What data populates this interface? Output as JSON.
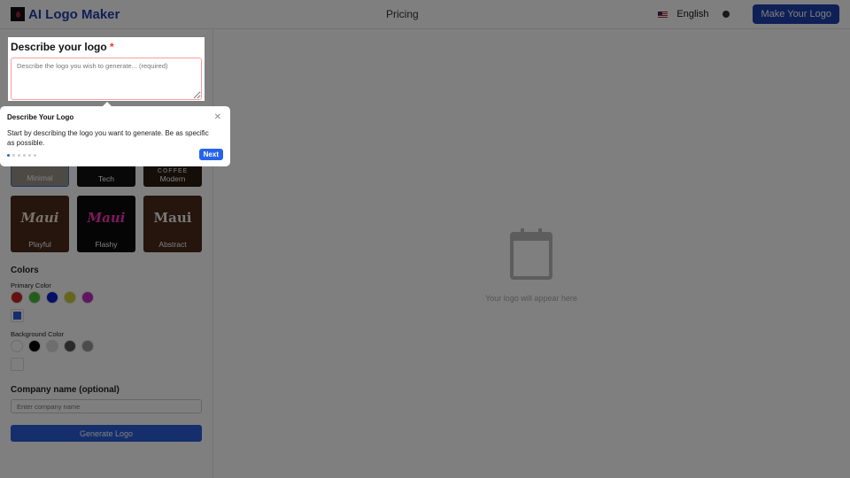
{
  "header": {
    "brand": "AI Logo Maker",
    "pricing": "Pricing",
    "language": "English",
    "cta": "Make Your Logo"
  },
  "describe": {
    "title": "Describe your logo",
    "required_mark": "*",
    "placeholder": "Describe the logo you wish to generate... (required)"
  },
  "tour": {
    "title": "Describe Your Logo",
    "body": "Start by describing the logo you want to generate. Be as specific as possible.",
    "next": "Next",
    "step": 1,
    "total_steps": 6
  },
  "styles": [
    {
      "label": "Minimal",
      "selected": true
    },
    {
      "label": "Tech"
    },
    {
      "label": "Modern",
      "art": "COFFEE"
    },
    {
      "label": "Playful",
      "art": "Maui"
    },
    {
      "label": "Flashy",
      "art": "Maui"
    },
    {
      "label": "Abstract",
      "art": "Maui"
    }
  ],
  "colors": {
    "title": "Colors",
    "primary_label": "Primary Color",
    "primary": [
      "#cc2222",
      "#44bb33",
      "#0a1ecc",
      "#cccc33",
      "#c22ac2"
    ],
    "primary_custom": "#2b5ed8",
    "background_label": "Background Color",
    "background": [
      "#ffffff",
      "#000000",
      "#dddddd",
      "#555555",
      "#999999"
    ],
    "background_custom": "#ffffff"
  },
  "company": {
    "title": "Company name (optional)",
    "placeholder": "Enter company name"
  },
  "generate": "Generate Logo",
  "preview": {
    "empty_text": "Your logo will appear here"
  }
}
